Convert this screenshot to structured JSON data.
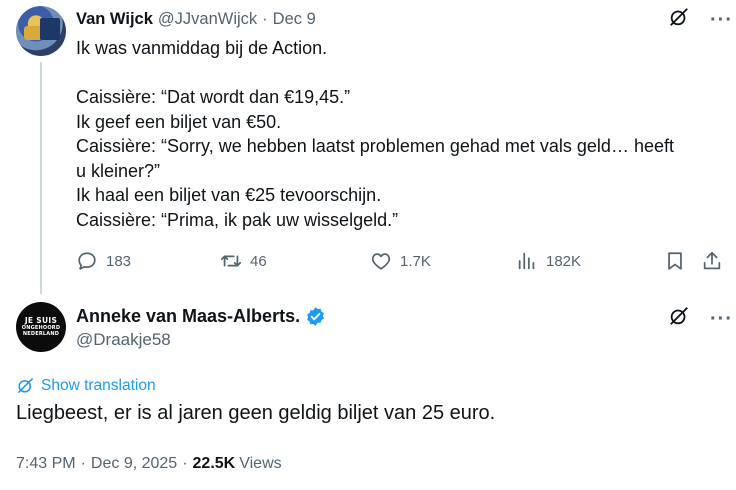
{
  "tweet1": {
    "author_name": "Van Wijck",
    "handle": "@JJvanWijck",
    "separator": "·",
    "date": "Dec 9",
    "lines": [
      "Ik was vanmiddag bij de Action.",
      "",
      "Caissière: “Dat wordt dan €19,45.”",
      "Ik geef een biljet van €50.",
      "Caissière: “Sorry, we hebben laatst problemen gehad met vals geld… heeft",
      "u kleiner?”",
      "Ik haal een biljet van €25 tevoorschijn.",
      "Caissière: “Prima, ik pak uw wisselgeld.”"
    ],
    "actions": {
      "replies": "183",
      "retweets": "46",
      "likes": "1.7K",
      "views": "182K"
    }
  },
  "tweet2": {
    "author_name": "Anneke van Maas-Alberts.",
    "handle": "@Draakje58",
    "avatar_text": [
      "JE SUIS",
      "ONGEHOORD",
      "NEDERLAND"
    ],
    "show_translation": "Show translation",
    "body": "Liegbeest, er is al jaren geen geldig biljet van 25 euro.",
    "time": "7:43 PM",
    "separator": "·",
    "date": "Dec 9, 2025",
    "views_count": "22.5K",
    "views_label": "Views"
  },
  "more_label": "···",
  "colors": {
    "accent": "#1d9bf0",
    "muted": "#536471",
    "text": "#0f1419",
    "thread_line": "#cfd9de"
  },
  "icons": [
    "grok-icon",
    "more-icon",
    "reply-icon",
    "retweet-icon",
    "like-icon",
    "views-icon",
    "bookmark-icon",
    "share-icon",
    "verified-badge-icon",
    "translate-icon"
  ]
}
